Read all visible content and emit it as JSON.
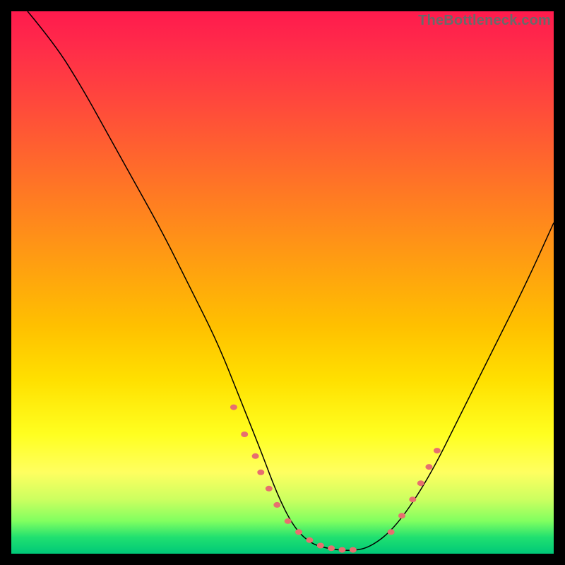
{
  "watermark": "TheBottleneck.com",
  "chart_data": {
    "type": "line",
    "title": "",
    "xlabel": "",
    "ylabel": "",
    "xlim": [
      0,
      100
    ],
    "ylim": [
      0,
      100
    ],
    "grid": false,
    "legend": false,
    "comment": "V-shaped curve over rainbow gradient; values are approximate percentages read from pixel positions (0 = bottom/left, 100 = top/right). No axis ticks or labels are visible.",
    "series": [
      {
        "name": "curve",
        "x": [
          3,
          8,
          13,
          18,
          23,
          28,
          33,
          38,
          42,
          46,
          49,
          52,
          55,
          58,
          62,
          66,
          71,
          77,
          83,
          89,
          95,
          100
        ],
        "y": [
          100,
          94,
          86,
          77,
          68,
          59,
          49,
          39,
          29,
          19,
          11,
          5,
          2,
          1,
          0.5,
          1,
          5,
          14,
          26,
          38,
          50,
          61
        ]
      },
      {
        "name": "markers",
        "x": [
          41,
          43,
          45,
          46,
          47.5,
          49,
          51,
          53,
          55,
          57,
          59,
          61,
          63,
          70,
          72,
          74,
          75.5,
          77,
          78.5
        ],
        "y": [
          27,
          22,
          18,
          15,
          12,
          9,
          6,
          4,
          2.5,
          1.5,
          1,
          0.7,
          0.7,
          4,
          7,
          10,
          13,
          16,
          19
        ]
      }
    ]
  }
}
